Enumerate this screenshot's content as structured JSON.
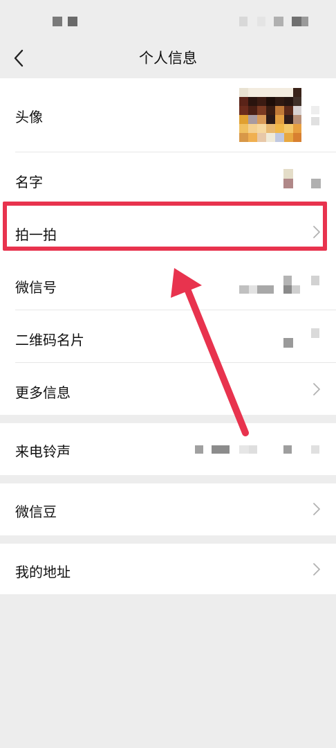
{
  "nav": {
    "title": "个人信息"
  },
  "rows": {
    "avatar": "头像",
    "name": "名字",
    "pat": "拍一拍",
    "wechat_id": "微信号",
    "qr": "二维码名片",
    "more": "更多信息",
    "ringtone": "来电铃声",
    "beans": "微信豆",
    "address": "我的地址"
  },
  "colors": {
    "highlight": "#e8334e",
    "background": "#ededed",
    "row_bg": "#ffffff"
  },
  "icons": {
    "back": "chevron-left-icon",
    "chevron": "chevron-right-icon"
  }
}
